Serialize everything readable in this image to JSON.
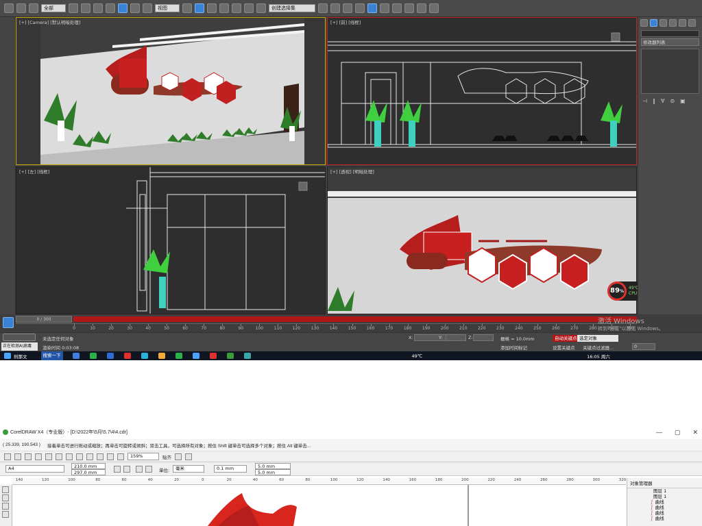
{
  "max": {
    "toolbar": {
      "filter": "全部",
      "view_dropdown": "视图",
      "selection_set": "创建选择集"
    },
    "viewports": {
      "camera": "[+] [Camera] [默认明暗处理]",
      "front": "[+] [前] [线框]",
      "left": "[+] [左] [线框]",
      "perspective": "[+] [透视] [明暗处理]"
    },
    "command_panel": {
      "modifier_list": "修改器列表",
      "stack_tools": [
        "⊣",
        "‖",
        "∀",
        "⊜",
        "▣"
      ]
    },
    "timeline": {
      "frame": "0 / 300",
      "ticks": [
        "0",
        "10",
        "20",
        "30",
        "40",
        "50",
        "60",
        "70",
        "80",
        "90",
        "100",
        "110",
        "120",
        "130",
        "140",
        "150",
        "160",
        "170",
        "180",
        "190",
        "200",
        "210",
        "220",
        "230",
        "240",
        "250",
        "260",
        "270",
        "280",
        "290",
        "300"
      ]
    },
    "status": {
      "listener": "正在检测A\\病毒",
      "selection": "未选定任何对象",
      "render_time": "渲染时间 0:03:08",
      "x": "X:",
      "y": "Y:",
      "z": "Z:",
      "grid": "栅格 = 10.0mm",
      "add_time_tag": "添加时间标记",
      "auto_key": "自动关键点",
      "set_key": "设置关键点",
      "selected_object": "选定对象",
      "key_filters": "关键点过滤器...",
      "frame_field": "0",
      "activate_windows": "激活 Windows",
      "activate_windows_sub": "转到\"设置\"以激活 Windows。"
    },
    "cpu": {
      "percent": "89",
      "unit": "%",
      "temp": "49℃",
      "label": "CPU温度"
    },
    "taskbar": {
      "start_label": "搜索一下",
      "left_item": "刹那文",
      "temp": "49℃",
      "time": "16:05 周六"
    }
  },
  "corel": {
    "title": "CorelDRAW X4（专业版）- [D:\\2022年\\5月\\5.7\\4\\4.cdr]",
    "window_controls": [
      "—",
      "▢",
      "✕"
    ],
    "hint_coords": "( 25.339, 190.543 )",
    "hint_text": "接着单击可进行拖动或缩放；再单击可旋转或倾斜；双击工具，可选择所有对象；按住 Shift 键单击可选择多个对象；按住 Alt 键单击...",
    "zoom": "159%",
    "snap": "贴齐",
    "page_size": "A4",
    "width": "210.0 mm",
    "height": "297.0 mm",
    "unit_label": "单位:",
    "unit": "毫米",
    "nudge": "0.1 mm",
    "dup_x": "5.0 mm",
    "dup_y": "5.0 mm",
    "ruler_labels": [
      "140",
      "120",
      "100",
      "80",
      "60",
      "40",
      "20",
      "0",
      "20",
      "40",
      "60",
      "80",
      "100",
      "120",
      "140",
      "160",
      "180",
      "200",
      "220",
      "240",
      "260",
      "280",
      "300",
      "320"
    ],
    "object_manager": {
      "title": "对象管理器",
      "layers": [
        "图层 1",
        "图层 1"
      ],
      "items": [
        "曲线",
        "曲线",
        "曲线",
        "曲线"
      ]
    }
  }
}
